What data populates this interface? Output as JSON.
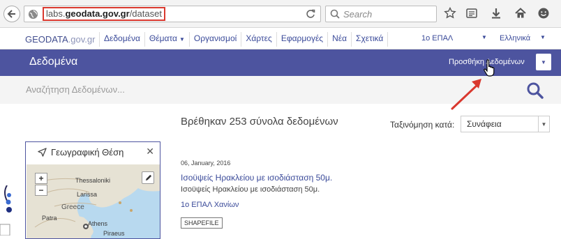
{
  "browser": {
    "url_domain_prefix": "labs.",
    "url_domain": "geodata.gov.gr",
    "url_path": "/dataset",
    "search_placeholder": "Search"
  },
  "site": {
    "logo_main": "GEODATA",
    "logo_tld": ".gov.gr",
    "nav": [
      "Δεδομένα",
      "Θέματα",
      "Οργανισμοί",
      "Χάρτες",
      "Εφαρμογές",
      "Νέα",
      "Σχετικά"
    ],
    "org_selector": "1ο ΕΠΑΛ",
    "language": "Ελληνικά"
  },
  "header": {
    "title": "Δεδομένα",
    "add_data": "Προσθήκη Δεδομένων"
  },
  "search": {
    "placeholder": "Αναζήτηση Δεδομένων..."
  },
  "results": {
    "count_text": "Βρέθηκαν 253 σύνολα δεδομένων",
    "sort_label": "Ταξινόμηση κατά:",
    "sort_value": "Συνάφεια"
  },
  "geo_panel": {
    "title": "Γεωγραφική Θέση",
    "map_labels": [
      "Thessaloniki",
      "Larissa",
      "Greece",
      "Athens",
      "Patra",
      "Piraeus"
    ]
  },
  "entry": {
    "date": "06, January, 2016",
    "title": "Ισοϋψείς Ηρακλείου με ισοδιάσταση 50μ.",
    "description": "Ισοϋψείς Ηρακλείου με ισοδιάσταση 50μ.",
    "organization": "1ο ΕΠΑΛ Χανίων",
    "format": "SHAPEFILE"
  },
  "colors": {
    "brand": "#4d549f",
    "highlight": "#d9382e",
    "link": "#3a4a99"
  }
}
